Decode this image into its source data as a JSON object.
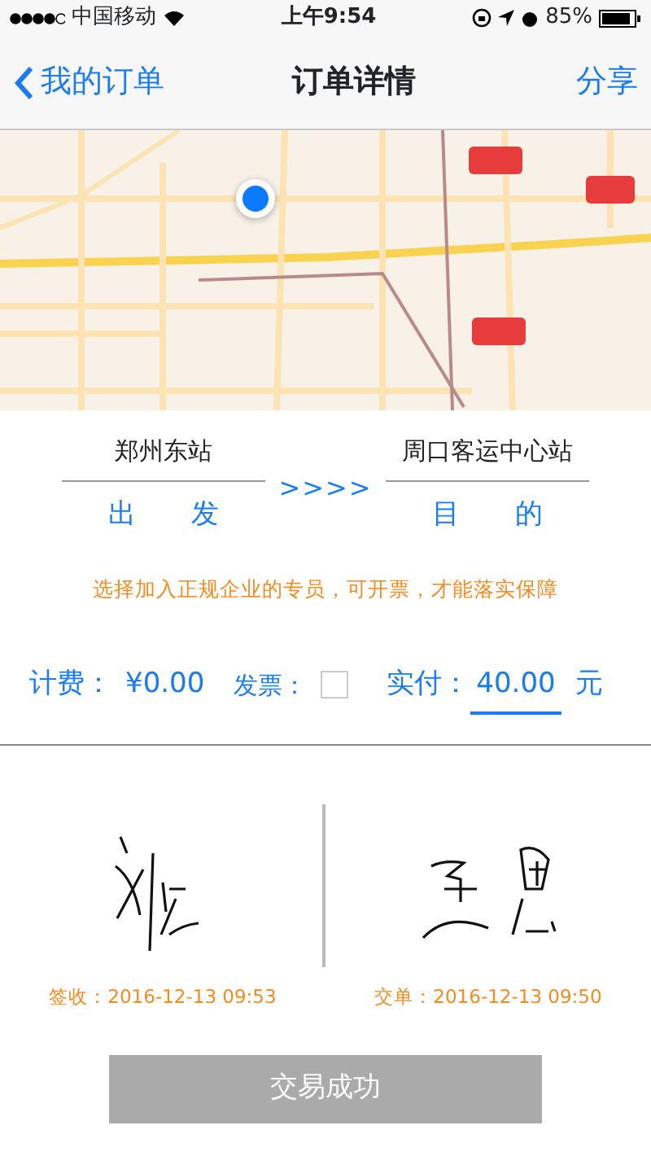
{
  "status_bar": {
    "carrier": "中国移动",
    "time": "上午9:54",
    "battery": "85%"
  },
  "nav": {
    "back": "我的订单",
    "title": "订单详情",
    "action": "分享"
  },
  "route": {
    "from": "郑州东站",
    "from_label": "出　　发",
    "arrow": ">>>>",
    "to": "周口客运中心站",
    "to_label": "目　　的"
  },
  "notice": "选择加入正规企业的专员，可开票，才能落实保障",
  "fees": {
    "fee_label": "计费：",
    "fee": "¥0.00",
    "invoice_label": "发票：",
    "invoice_checked": false,
    "paid_label": "实付：",
    "paid": "40.00",
    "unit": "元"
  },
  "signatures": [
    {
      "caption": "签收：2016-12-13 09:53"
    },
    {
      "caption": "交单：2016-12-13 09:50"
    }
  ],
  "button": {
    "label": "交易成功",
    "disabled": true
  }
}
